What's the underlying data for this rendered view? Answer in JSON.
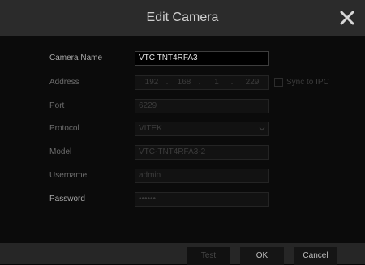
{
  "dialog": {
    "title": "Edit Camera"
  },
  "form": {
    "camera_name": {
      "label": "Camera Name",
      "value": "VTC TNT4RFA3"
    },
    "address": {
      "label": "Address",
      "octets": [
        "192",
        "168",
        "1",
        "229"
      ],
      "separator": ".",
      "sync_label": "Sync to IPC"
    },
    "port": {
      "label": "Port",
      "value": "6229"
    },
    "protocol": {
      "label": "Protocol",
      "value": "VITEK"
    },
    "model": {
      "label": "Model",
      "value": "VTC-TNT4RFA3-2"
    },
    "username": {
      "label": "Username",
      "value": "admin"
    },
    "password": {
      "label": "Password",
      "value": "••••••"
    }
  },
  "buttons": {
    "test": "Test",
    "ok": "OK",
    "cancel": "Cancel"
  },
  "icons": {
    "close": "close-icon",
    "dropdown": "chevron-down-icon"
  }
}
